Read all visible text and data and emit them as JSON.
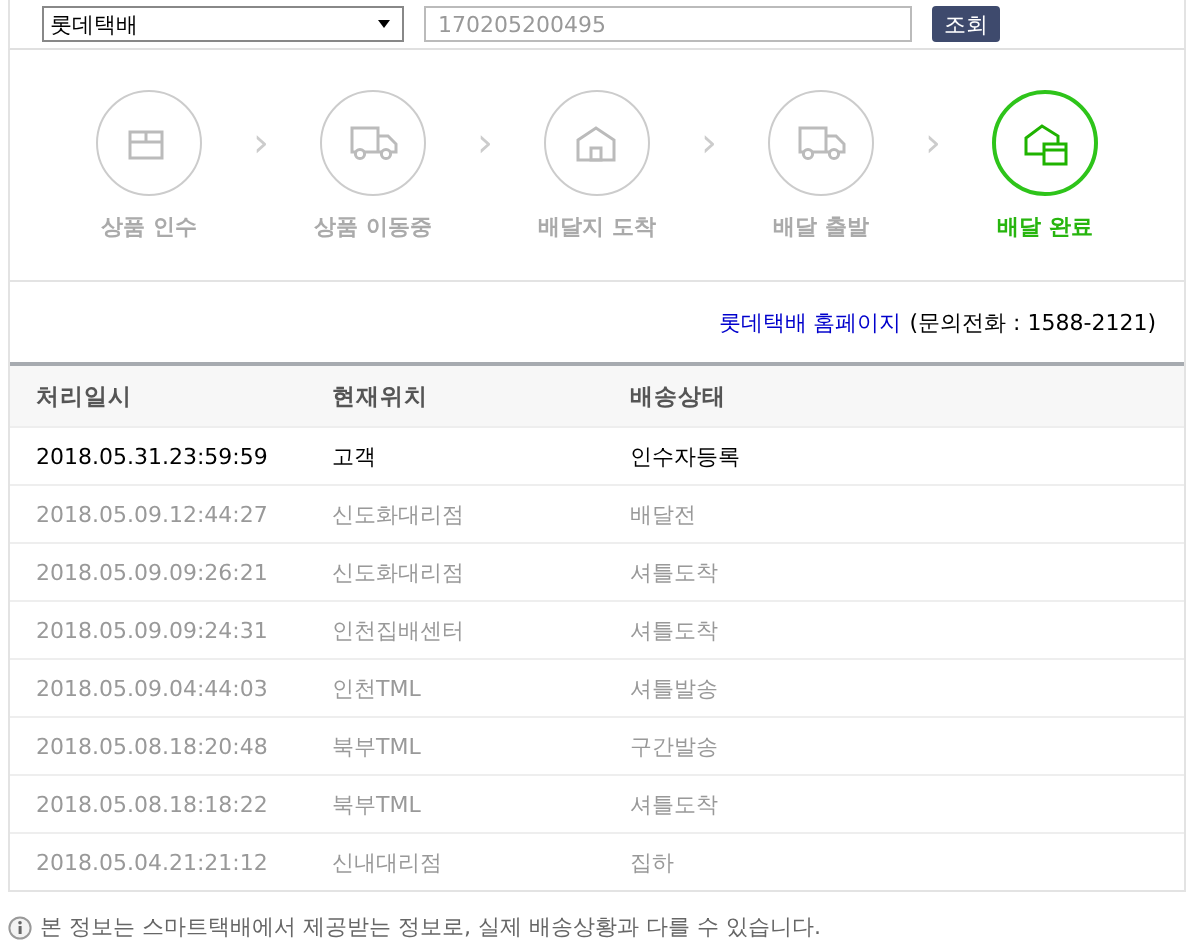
{
  "search": {
    "carrier": "롯데택배",
    "tracking_number": "170205200495",
    "button": "조회"
  },
  "steps": [
    {
      "label": "상품 인수",
      "kind": "box",
      "selected": false
    },
    {
      "label": "상품 이동중",
      "kind": "truck",
      "selected": false
    },
    {
      "label": "배달지 도착",
      "kind": "house",
      "selected": false
    },
    {
      "label": "배달 출발",
      "kind": "truck",
      "selected": false
    },
    {
      "label": "배달 완료",
      "kind": "delivered",
      "selected": true
    }
  ],
  "separator": "›",
  "links": {
    "homepage": "롯데택배 홈페이지",
    "phone": "(문의전화 : 1588-2121)"
  },
  "table": {
    "columns": [
      "처리일시",
      "현재위치",
      "배송상태"
    ],
    "rows": [
      {
        "cells": [
          "2018.05.31.23:59:59",
          "고객",
          "인수자등록"
        ],
        "current": true
      },
      {
        "cells": [
          "2018.05.09.12:44:27",
          "신도화대리점",
          "배달전"
        ],
        "current": false
      },
      {
        "cells": [
          "2018.05.09.09:26:21",
          "신도화대리점",
          "셔틀도착"
        ],
        "current": false
      },
      {
        "cells": [
          "2018.05.09.09:24:31",
          "인천집배센터",
          "셔틀도착"
        ],
        "current": false
      },
      {
        "cells": [
          "2018.05.09.04:44:03",
          "인천TML",
          "셔틀발송"
        ],
        "current": false
      },
      {
        "cells": [
          "2018.05.08.18:20:48",
          "북부TML",
          "구간발송"
        ],
        "current": false
      },
      {
        "cells": [
          "2018.05.08.18:18:22",
          "북부TML",
          "셔틀도착"
        ],
        "current": false
      },
      {
        "cells": [
          "2018.05.04.21:21:12",
          "신내대리점",
          "집하"
        ],
        "current": false
      }
    ]
  },
  "notice": "본 정보는 스마트택배에서 제공받는 정보로, 실제 배송상황과 다를 수 있습니다."
}
